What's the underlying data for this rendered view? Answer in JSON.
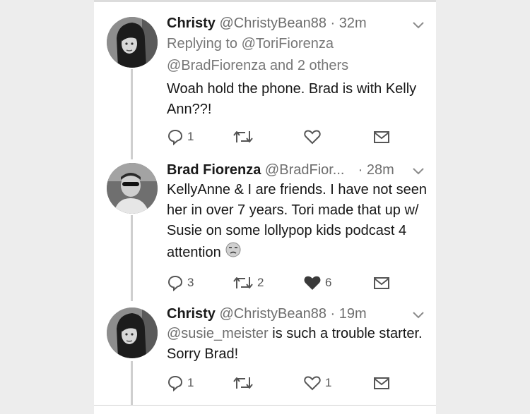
{
  "tweets": [
    {
      "name": "Christy",
      "handle": "@ChristyBean88",
      "dot": "·",
      "time": "32m",
      "reply_prefix": "Replying to",
      "reply_target": "@ToriFiorenza",
      "reply_line2_mention": "@BradFiorenza",
      "reply_line2_rest": " and 2 others",
      "text": "Woah hold the phone. Brad is with Kelly Ann??!",
      "replies": "1",
      "retweets": "",
      "likes": "",
      "liked": false
    },
    {
      "name": "Brad Fiorenza",
      "handle": "@BradFior...",
      "dot": "·",
      "time": "28m",
      "text": "KellyAnne & I are friends. I have not seen her in over 7 years. Tori made that up w/ Susie on some lollypop kids podcast 4 attention",
      "emoji": "unamused-face-emoji",
      "replies": "3",
      "retweets": "2",
      "likes": "6",
      "liked": true
    },
    {
      "name": "Christy",
      "handle": "@ChristyBean88",
      "dot": "·",
      "time": "19m",
      "mention": "@susie_meister",
      "text": " is such a trouble starter. Sorry Brad!",
      "replies": "1",
      "retweets": "",
      "likes": "1",
      "liked": false
    }
  ],
  "colors": {
    "card_bg": "#ffffff",
    "page_bg": "#ededed",
    "thread_line": "#cfcfcf",
    "muted_text": "#6e6e6e",
    "liked_heart": "#3a3a3a"
  }
}
